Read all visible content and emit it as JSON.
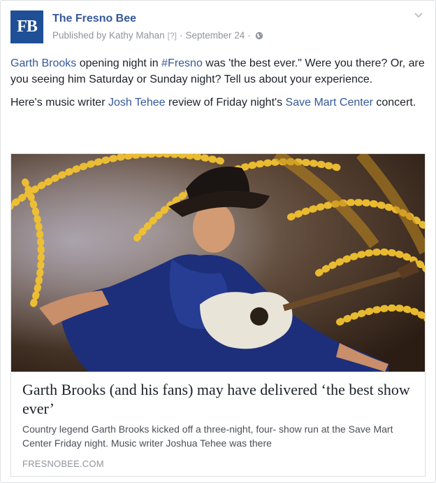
{
  "post": {
    "logo_text": "FB",
    "page_name": "The Fresno Bee",
    "published_by": "Published by Kathy Mahan",
    "help_marker": "[?]",
    "separator": "·",
    "date": "September 24",
    "separator2": "·"
  },
  "message": {
    "p1": {
      "link1": "Garth Brooks",
      "t1": " opening night in ",
      "hashtag": "#Fresno",
      "t2": " was 'the best ever.\" Were you there? Or, are you seeing him Saturday or Sunday night? Tell us about your experience."
    },
    "p2": {
      "t1": "Here's music writer ",
      "link1": "Josh Tehee",
      "t2": " review of Friday night's ",
      "link2": "Save Mart Center",
      "t3": " concert."
    }
  },
  "attachment": {
    "title": "Garth Brooks (and his fans) may have delivered ‘the best show ever’",
    "description": "Country legend Garth Brooks kicked off a three-night, four- show run at the Save Mart Center Friday night. Music writer Joshua Tehee was there",
    "domain": "FRESNOBEE.COM"
  },
  "colors": {
    "brand_blue": "#1f4f96",
    "link": "#365899",
    "muted": "#90949c"
  },
  "icons": {
    "chevron": "chevron-down-icon",
    "globe": "globe-icon"
  }
}
